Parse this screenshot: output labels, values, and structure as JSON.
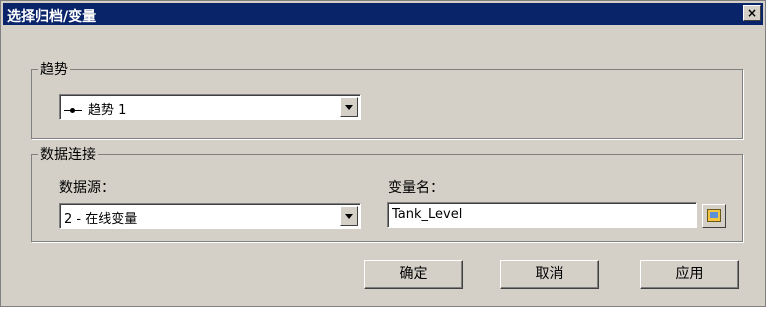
{
  "dialog": {
    "title": "选择归档/变量",
    "close_label": "×"
  },
  "trend_group": {
    "legend": "趋势",
    "selected_trend": "趋势 1"
  },
  "data_connection": {
    "legend": "数据连接",
    "source_label": "数据源：",
    "source_value": "2 - 在线变量",
    "variable_label": "变量名：",
    "variable_value": "Tank_Level"
  },
  "buttons": {
    "ok": "确定",
    "cancel": "取消",
    "apply": "应用"
  },
  "colors": {
    "titlebar": "#0a246a",
    "face": "#d4d0c8"
  }
}
